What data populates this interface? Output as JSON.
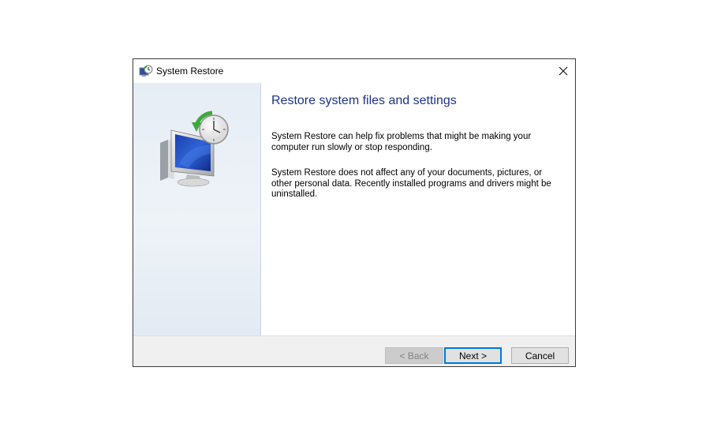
{
  "window": {
    "title": "System Restore",
    "title_icon": "system-restore-icon",
    "close_icon": "close-icon"
  },
  "sidebar": {
    "illustration": "computer-clock-restore-icon"
  },
  "main": {
    "heading": "Restore system files and settings",
    "paragraph1": "System Restore can help fix problems that might be making your computer run slowly or stop responding.",
    "paragraph2": "System Restore does not affect any of your documents, pictures, or other personal data. Recently installed programs and drivers might be uninstalled."
  },
  "buttons": {
    "back_label": "< Back",
    "back_enabled": false,
    "next_label": "Next >",
    "next_default": true,
    "cancel_label": "Cancel"
  },
  "colors": {
    "heading": "#1e3287",
    "focus_border": "#0078d7",
    "sidebar_bg": "#e6edf5"
  }
}
